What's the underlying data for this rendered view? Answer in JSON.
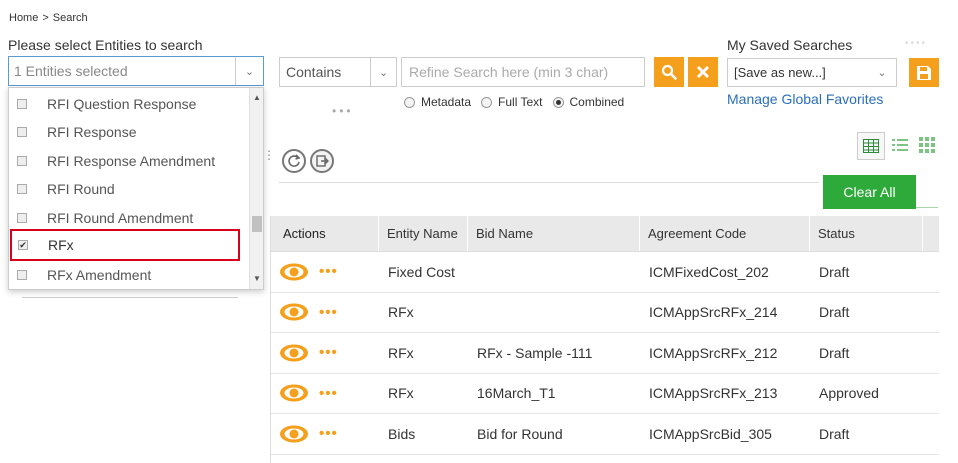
{
  "breadcrumb": {
    "home": "Home",
    "separator": ">",
    "current": "Search"
  },
  "entity_picker": {
    "label": "Please select Entities to search",
    "selected_text": "1 Entities selected",
    "options": [
      {
        "label": "RFI Question Response",
        "checked": false
      },
      {
        "label": "RFI Response",
        "checked": false
      },
      {
        "label": "RFI Response Amendment",
        "checked": false
      },
      {
        "label": "RFI Round",
        "checked": false
      },
      {
        "label": "RFI Round Amendment",
        "checked": false
      },
      {
        "label": "RFx",
        "checked": true
      },
      {
        "label": "RFx Amendment",
        "checked": false
      }
    ]
  },
  "search": {
    "operator": "Contains",
    "placeholder": "Refine Search here (min 3 char)",
    "modes": [
      {
        "label": "Metadata",
        "selected": false
      },
      {
        "label": "Full Text",
        "selected": false
      },
      {
        "label": "Combined",
        "selected": true
      }
    ]
  },
  "saved_searches": {
    "label": "My Saved Searches",
    "selected": "[Save as new...]",
    "manage_link": "Manage Global Favorites"
  },
  "toolbar": {
    "clear_all": "Clear All"
  },
  "table": {
    "headers": {
      "actions": "Actions",
      "entity": "Entity Name",
      "bid": "Bid Name",
      "agreement": "Agreement Code",
      "status": "Status"
    },
    "rows": [
      {
        "entity": "Fixed Cost",
        "bid": "",
        "agreement": "ICMFixedCost_202",
        "status": "Draft"
      },
      {
        "entity": "RFx",
        "bid": "",
        "agreement": "ICMAppSrcRFx_214",
        "status": "Draft"
      },
      {
        "entity": "RFx",
        "bid": "RFx - Sample -111",
        "agreement": "ICMAppSrcRFx_212",
        "status": "Draft"
      },
      {
        "entity": "RFx",
        "bid": "16March_T1",
        "agreement": "ICMAppSrcRFx_213",
        "status": "Approved"
      },
      {
        "entity": "Bids",
        "bid": "Bid for Round",
        "agreement": "ICMAppSrcBid_305",
        "status": "Draft"
      }
    ]
  },
  "colors": {
    "accent": "#f4a01c",
    "success": "#2eaa3a",
    "link": "#2a6ebb",
    "highlight": "#d9001b"
  },
  "icons": {
    "search_button": "search-icon",
    "clear_button": "close-icon",
    "save_button": "save-icon",
    "refresh": "refresh-icon",
    "export": "export-icon",
    "row_view": "eye-icon",
    "row_more": "more-icon",
    "view_grid": "grid-view-icon",
    "view_list": "list-view-icon",
    "view_tile": "tile-view-icon"
  }
}
